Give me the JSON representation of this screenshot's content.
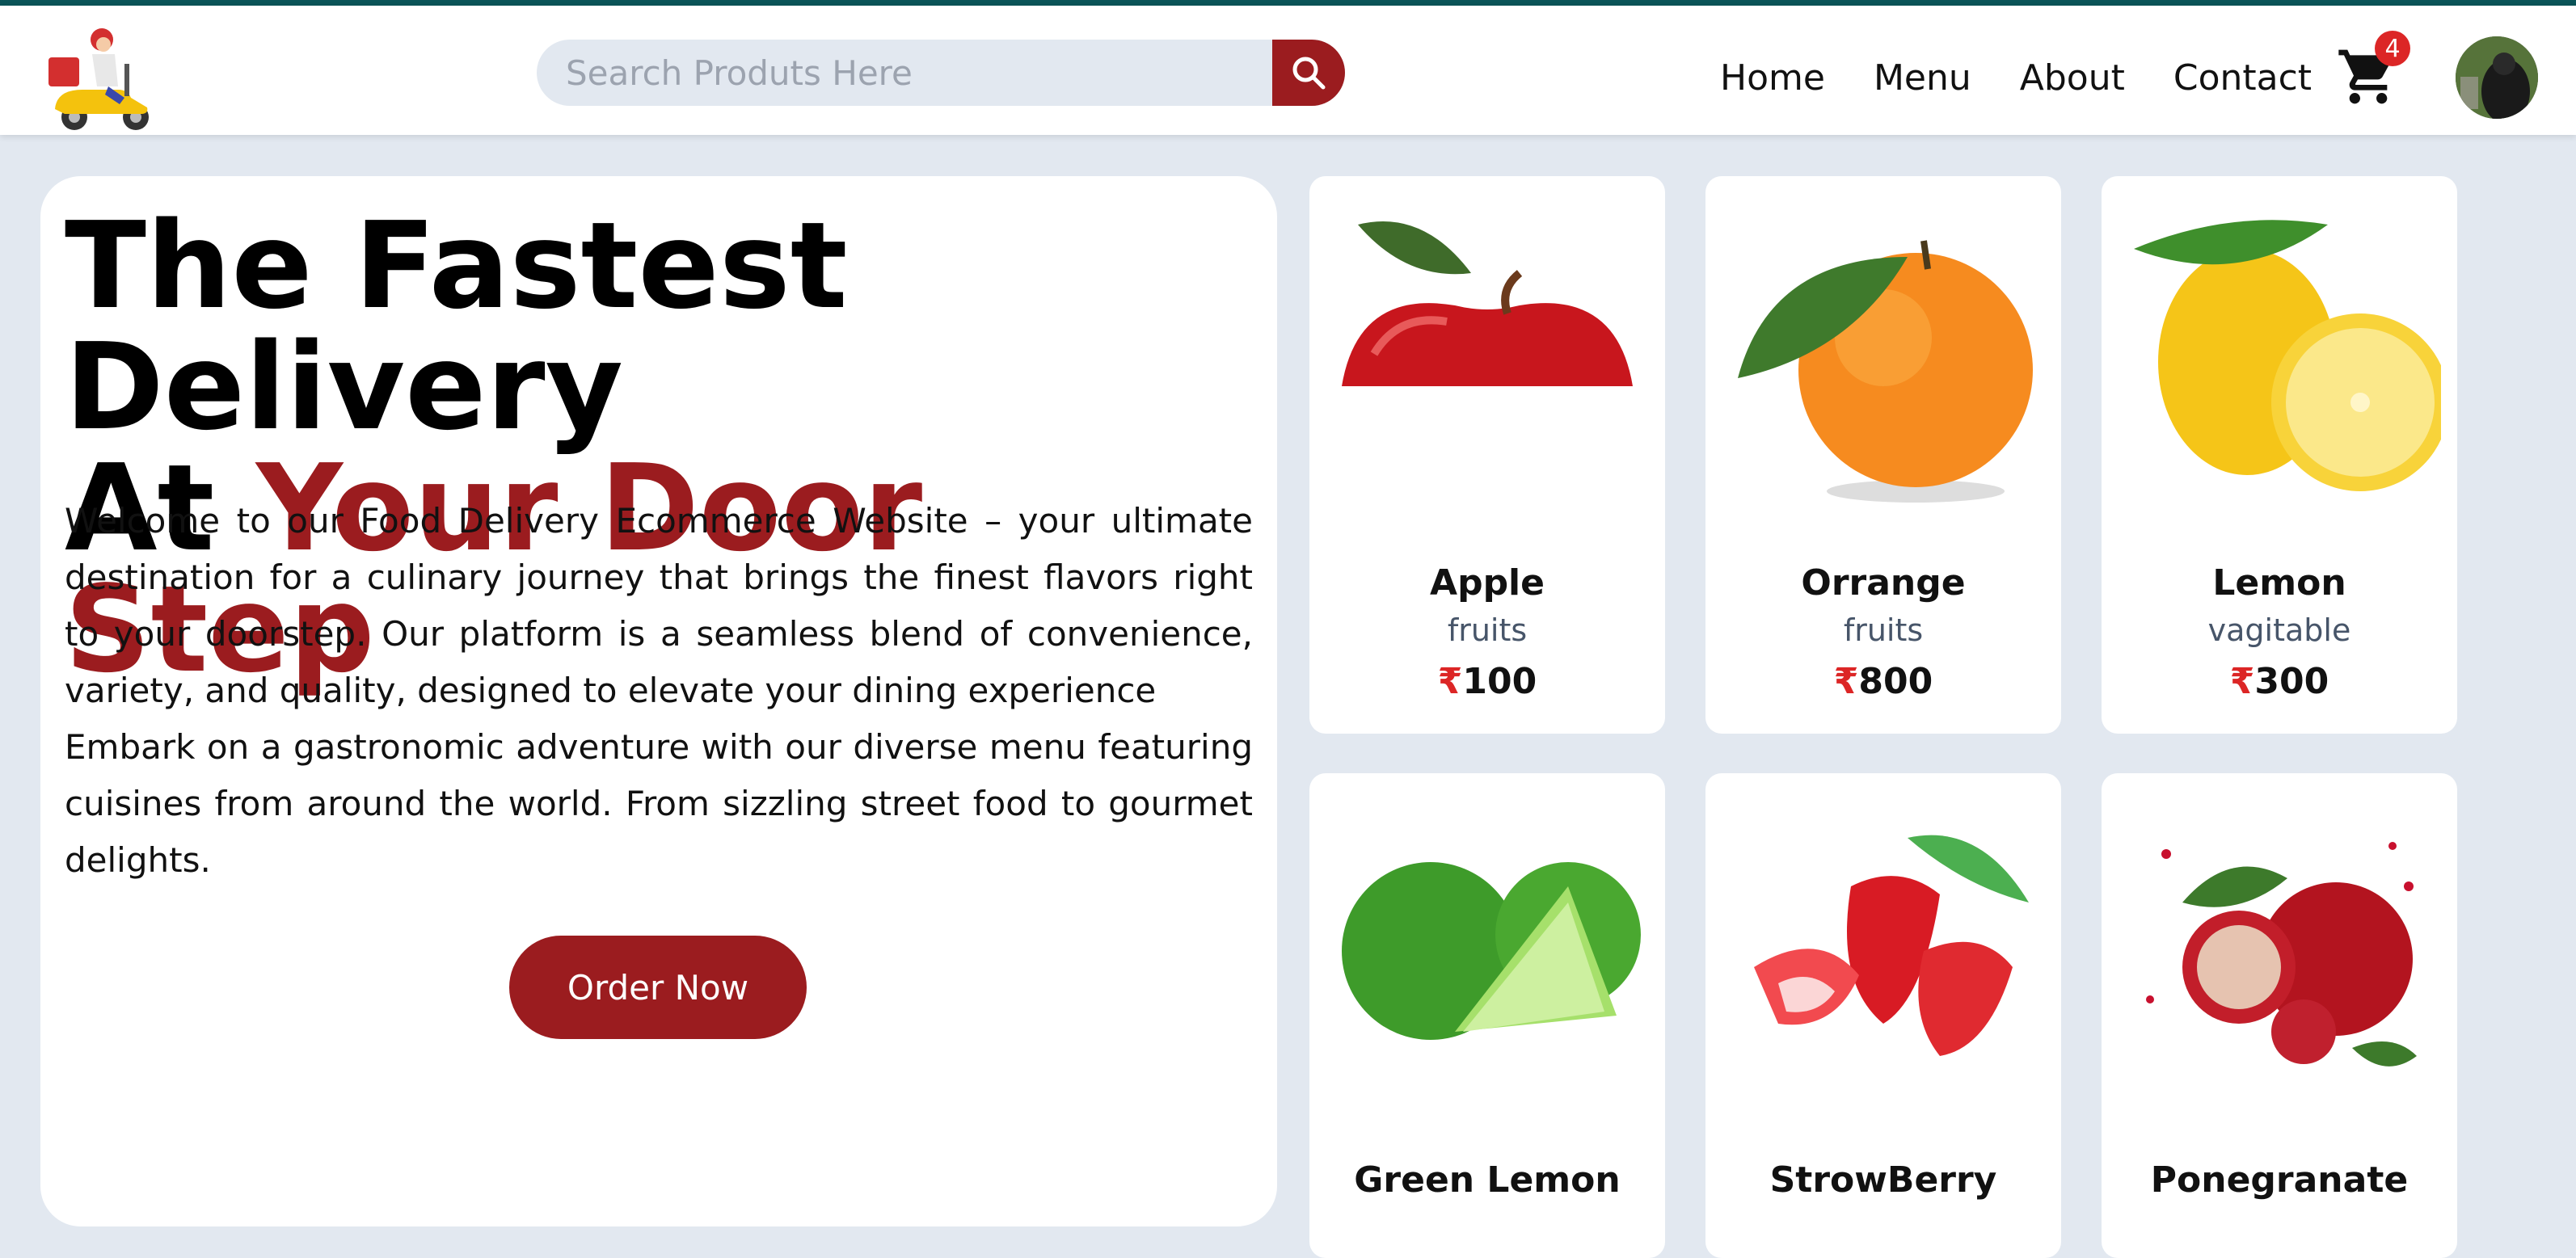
{
  "header": {
    "search_placeholder": "Search Produts Here",
    "nav": [
      "Home",
      "Menu",
      "About",
      "Contact"
    ],
    "cart_count": "4"
  },
  "hero": {
    "title_line1": "The Fastest Delivery",
    "title_line2_prefix": "At ",
    "title_line2_accent": "Your Door Step",
    "paragraph1": "Welcome to our Food Delivery Ecommerce Website – your ultimate destination for a culinary journey that brings the finest flavors right to your doorstep. Our platform is a seamless blend of convenience, variety, and quality, designed to elevate your dining experience",
    "paragraph2": "Embark on a gastronomic adventure with our diverse menu featuring cuisines from around the world. From sizzling street food to gourmet delights.",
    "order_button": "Order Now"
  },
  "products": [
    {
      "name": "Apple",
      "category": "fruits",
      "currency": "₹",
      "price": "100"
    },
    {
      "name": "Orrange",
      "category": "fruits",
      "currency": "₹",
      "price": "800"
    },
    {
      "name": "Lemon",
      "category": "vagitable",
      "currency": "₹",
      "price": "300"
    },
    {
      "name": "Green Lemon",
      "category": "",
      "currency": "",
      "price": ""
    },
    {
      "name": "StrowBerry",
      "category": "",
      "currency": "",
      "price": ""
    },
    {
      "name": "Ponegranate",
      "category": "",
      "currency": "",
      "price": ""
    }
  ],
  "colors": {
    "accent": "#9b1c1f",
    "page_bg": "#e2e8f0",
    "top_line": "#0b5458",
    "badge": "#dc2626"
  }
}
